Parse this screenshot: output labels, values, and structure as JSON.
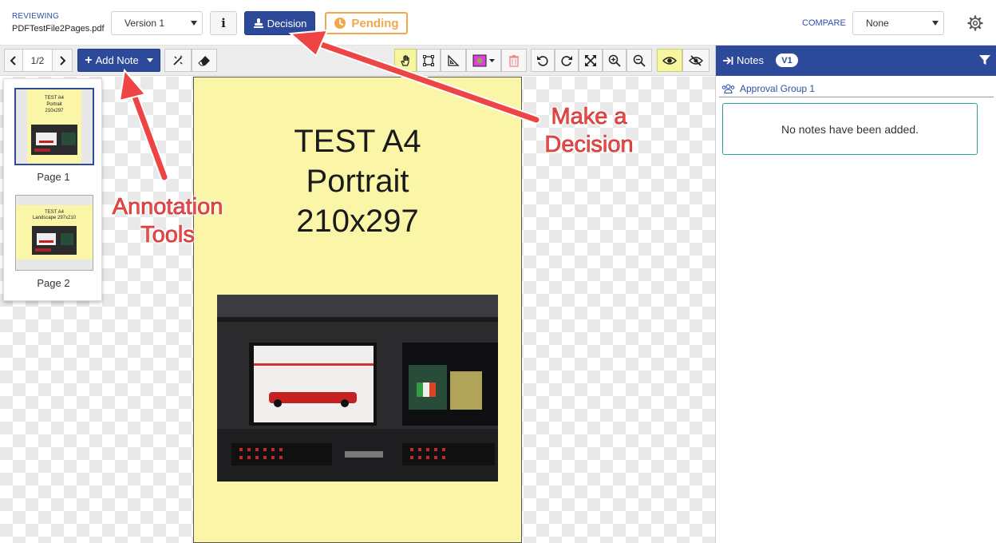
{
  "header": {
    "reviewing_label": "REVIEWING",
    "file_name": "PDFTestFile2Pages.pdf",
    "version_select": "Version 1",
    "info_label": "i",
    "decision_label": "Decision",
    "status_label": "Pending",
    "compare_label": "COMPARE",
    "compare_select": "None"
  },
  "toolbar": {
    "page_indicator": "1/2",
    "add_note_label": "Add Note"
  },
  "thumbnails": [
    {
      "label": "Page 1",
      "text_lines": [
        "TEST A4",
        "Portrait",
        "210x297"
      ]
    },
    {
      "label": "Page 2",
      "text_lines": [
        "TEST A4",
        "Landscape 297x210"
      ]
    }
  ],
  "document": {
    "title_lines": [
      "TEST A4",
      "Portrait",
      "210x297"
    ]
  },
  "notes": {
    "title": "Notes",
    "version_badge": "V1",
    "group_name": "Approval Group 1",
    "empty_message": "No notes have been added."
  },
  "annotations": {
    "decision_callout": [
      "Make a",
      "Decision"
    ],
    "tools_callout": [
      "Annotation",
      "Tools"
    ]
  },
  "colors": {
    "brand_blue": "#2d4a9a",
    "pending_orange": "#f0a84a",
    "page_yellow": "#faf5a7",
    "highlight_yellow": "#f6f5a0",
    "annotation_red": "#ef4a4a",
    "empty_border_teal": "#2aa198"
  },
  "icons": [
    "stamp-icon",
    "clock-icon",
    "gear-icon",
    "chevron-left-icon",
    "chevron-right-icon",
    "magic-wand-icon",
    "eraser-icon",
    "hand-icon",
    "crop-icon",
    "ruler-icon",
    "color-swatch-icon",
    "trash-icon",
    "rotate-left-icon",
    "rotate-right-icon",
    "fit-icon",
    "zoom-in-icon",
    "zoom-out-icon",
    "eye-icon",
    "eye-slash-icon",
    "collapse-arrow-icon",
    "filter-icon",
    "users-icon"
  ]
}
